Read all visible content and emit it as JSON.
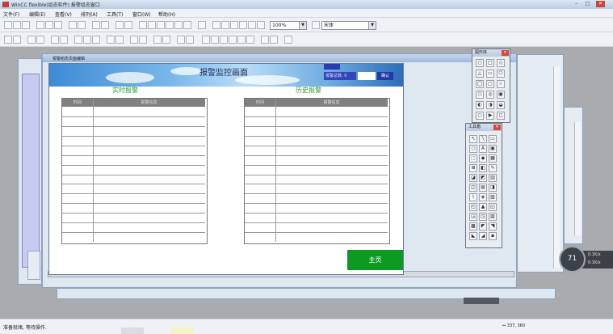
{
  "window": {
    "title": "WinCC flexible(组态软件)   报警组态窗口   ",
    "controls": {
      "minimize": "–",
      "maximize": "□",
      "close": "✕"
    }
  },
  "menu": [
    "文件(F)",
    "编辑(E)",
    "查看(V)",
    "排列(A)",
    "工具(T)",
    "窗口(W)",
    "帮助(H)"
  ],
  "toolbar": {
    "zoom_value": "100%",
    "font_value": "宋体"
  },
  "child_window": {
    "title": "报警组态页面编辑"
  },
  "screen": {
    "header_title": "报警监控画面",
    "header_small_top": "",
    "header_small_bottom": "报警总数: 0",
    "header_button": "确认",
    "realtime": {
      "title": "实时报警",
      "columns": [
        "时间",
        "报警信息"
      ],
      "rows": 14
    },
    "history": {
      "title": "历史报警",
      "columns": [
        "时间",
        "报警信息"
      ],
      "rows": 14
    },
    "main_button": "主页"
  },
  "palettes": {
    "shapes": {
      "title": "图形库"
    },
    "tools": {
      "title": "工具箱"
    }
  },
  "zoom_indicator": {
    "value": "71",
    "line1": "0.1K/s",
    "line2": "0.1K/s"
  },
  "status": {
    "text": "准备就绪, 等待操作.",
    "coords": "↔ 337, 360"
  },
  "colors": {
    "accent_green": "#0c9a22",
    "section_green": "#2a9a32",
    "table_header": "#808080"
  }
}
